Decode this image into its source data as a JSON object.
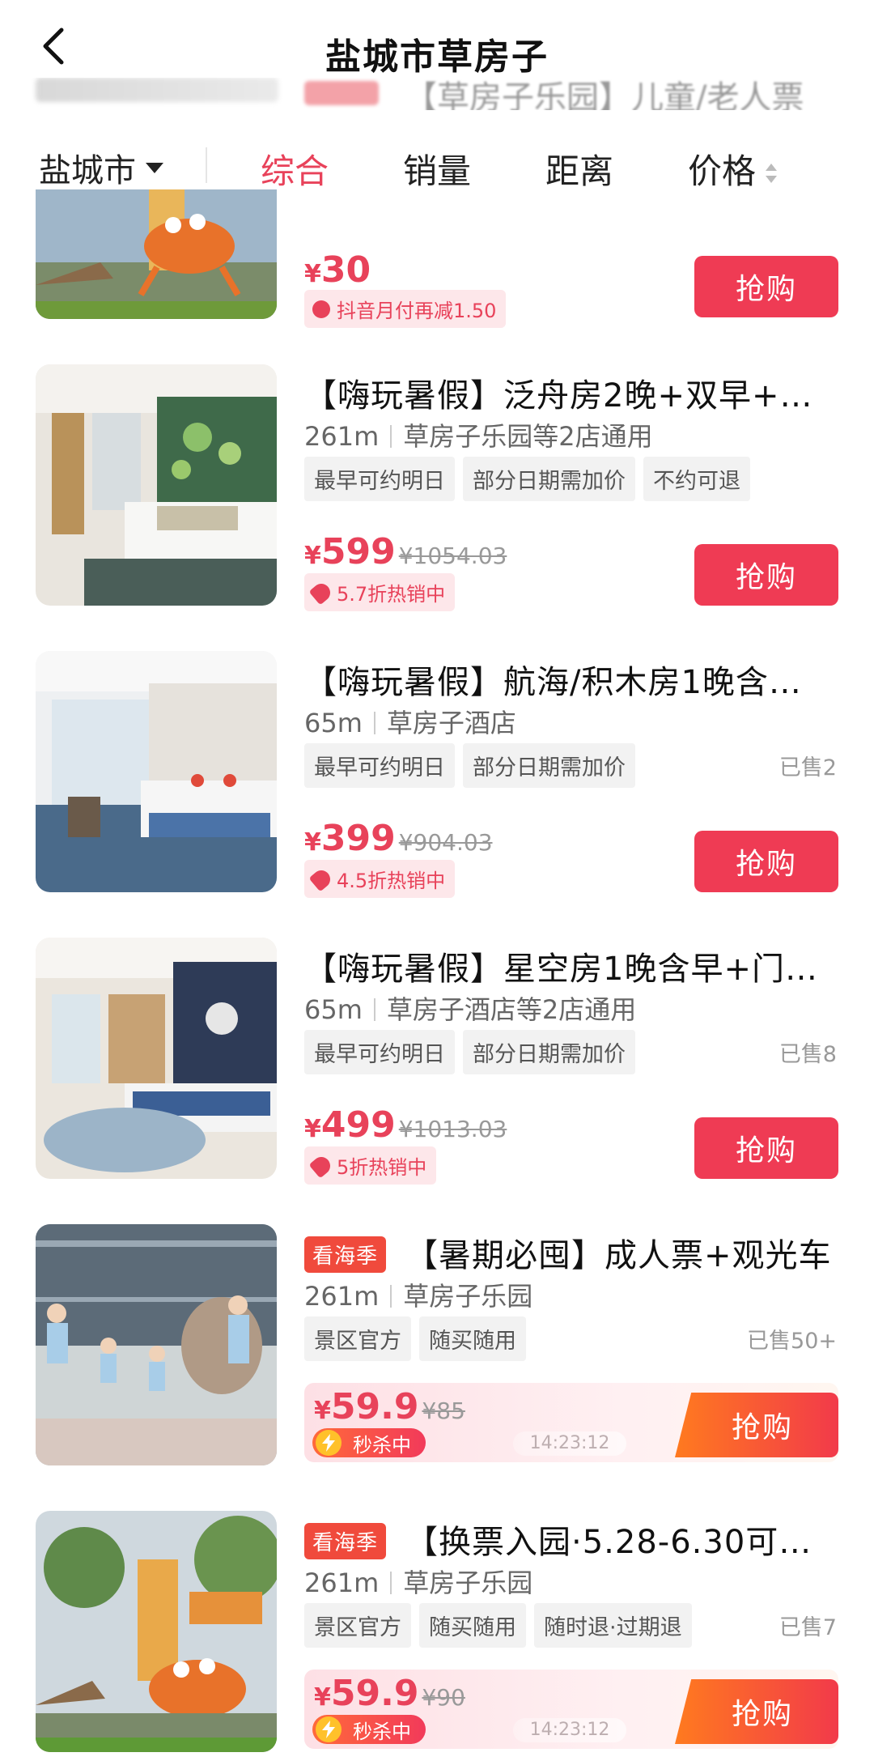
{
  "header": {
    "title": "盐城市草房子"
  },
  "ghost_row": {
    "text": "【草房子乐园】儿童/老人票"
  },
  "filters": {
    "city": "盐城市",
    "sorts": [
      "综合",
      "销量",
      "距离",
      "价格"
    ],
    "active_sort": "综合"
  },
  "items": [
    {
      "price": "30",
      "promo": "抖音月付再减1.50",
      "button": "抢购"
    },
    {
      "title": "【嗨玩暑假】泛舟房2晚+双早+…",
      "distance": "261m",
      "venue": "草房子乐园等2店通用",
      "tags": [
        "最早可约明日",
        "部分日期需加价",
        "不约可退"
      ],
      "price": "599",
      "orig_price": "¥1054.03",
      "promo": "5.7折热销中",
      "button": "抢购"
    },
    {
      "title": "【嗨玩暑假】航海/积木房1晚含…",
      "distance": "65m",
      "venue": "草房子酒店",
      "tags": [
        "最早可约明日",
        "部分日期需加价"
      ],
      "sold": "已售2",
      "price": "399",
      "orig_price": "¥904.03",
      "promo": "4.5折热销中",
      "button": "抢购"
    },
    {
      "title": "【嗨玩暑假】星空房1晚含早+门…",
      "distance": "65m",
      "venue": "草房子酒店等2店通用",
      "tags": [
        "最早可约明日",
        "部分日期需加价"
      ],
      "sold": "已售8",
      "price": "499",
      "orig_price": "¥1013.03",
      "promo": "5折热销中",
      "button": "抢购"
    },
    {
      "badge": "看海季",
      "title": "【暑期必囤】成人票+观光车",
      "distance": "261m",
      "venue": "草房子乐园",
      "tags": [
        "景区官方",
        "随买随用"
      ],
      "sold": "已售50+",
      "price": "59.9",
      "orig_price": "¥85",
      "flash_label": "秒杀中",
      "timer": "14:23:12",
      "button": "抢购"
    },
    {
      "badge": "看海季",
      "title": "【换票入园·5.28-6.30可…",
      "distance": "261m",
      "venue": "草房子乐园",
      "tags": [
        "景区官方",
        "随买随用",
        "随时退·过期退"
      ],
      "sold": "已售7",
      "price": "59.9",
      "orig_price": "¥90",
      "flash_label": "秒杀中",
      "timer": "14:23:12",
      "button": "抢购"
    }
  ],
  "currency_symbol": "¥",
  "colors": {
    "accent": "#e8425a",
    "button": "#ef3b54",
    "badge": "#f04a3c"
  }
}
